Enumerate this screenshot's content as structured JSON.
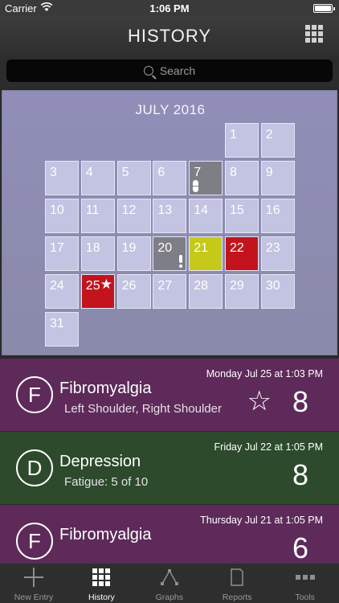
{
  "status_bar": {
    "carrier": "Carrier",
    "time": "1:06 PM",
    "battery_level": 1.0
  },
  "nav": {
    "title": "HISTORY",
    "right_icon": "grid-icon"
  },
  "search": {
    "placeholder": "Search"
  },
  "calendar": {
    "month": "JULY 2016",
    "days": [
      {
        "n": "1"
      },
      {
        "n": "2"
      },
      {
        "n": "3"
      },
      {
        "n": "4"
      },
      {
        "n": "5"
      },
      {
        "n": "6"
      },
      {
        "n": "7",
        "style": "gray",
        "icon": "pill-icon"
      },
      {
        "n": "8"
      },
      {
        "n": "9"
      },
      {
        "n": "10"
      },
      {
        "n": "11"
      },
      {
        "n": "12"
      },
      {
        "n": "13"
      },
      {
        "n": "14"
      },
      {
        "n": "15"
      },
      {
        "n": "16"
      },
      {
        "n": "17"
      },
      {
        "n": "18"
      },
      {
        "n": "19"
      },
      {
        "n": "20",
        "style": "gray",
        "icon": "exclamation-icon"
      },
      {
        "n": "21",
        "style": "yellow"
      },
      {
        "n": "22",
        "style": "red"
      },
      {
        "n": "23"
      },
      {
        "n": "24"
      },
      {
        "n": "25",
        "style": "red",
        "icon": "star-icon"
      },
      {
        "n": "26"
      },
      {
        "n": "27"
      },
      {
        "n": "28"
      },
      {
        "n": "29"
      },
      {
        "n": "30"
      },
      {
        "n": "31"
      }
    ]
  },
  "entries": [
    {
      "letter": "F",
      "title": "Fibromyalgia",
      "subtitle": "Left Shoulder, Right Shoulder",
      "date": "Monday Jul 25 at 1:03 PM",
      "value": "8",
      "starred": true,
      "color": "#5d2a5a"
    },
    {
      "letter": "D",
      "title": "Depression",
      "subtitle": "Fatigue: 5 of 10",
      "date": "Friday Jul 22 at 1:05 PM",
      "value": "8",
      "starred": false,
      "color": "#2d4a2c"
    },
    {
      "letter": "F",
      "title": "Fibromyalgia",
      "subtitle": "",
      "date": "Thursday Jul 21 at 1:05 PM",
      "value": "6",
      "starred": false,
      "color": "#5d2a5a"
    }
  ],
  "tabs": [
    {
      "label": "New Entry",
      "icon": "plus-icon"
    },
    {
      "label": "History",
      "icon": "grid-icon",
      "active": true
    },
    {
      "label": "Graphs",
      "icon": "graph-icon"
    },
    {
      "label": "Reports",
      "icon": "report-icon"
    },
    {
      "label": "Tools",
      "icon": "more-icon"
    }
  ]
}
